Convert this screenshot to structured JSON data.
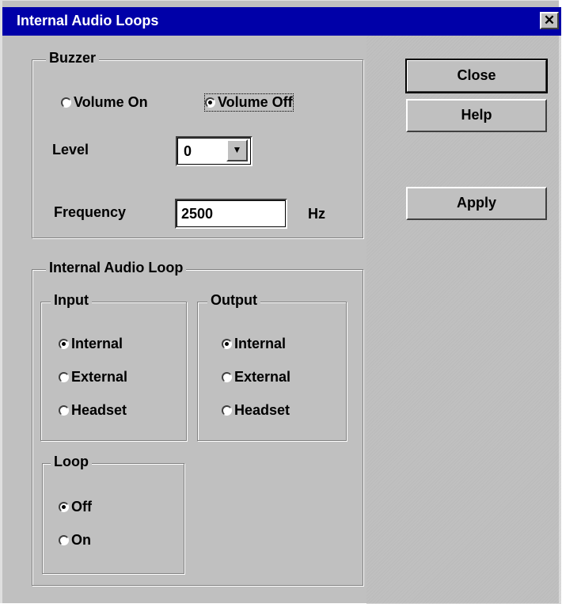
{
  "window": {
    "title": "Internal Audio Loops",
    "close_glyph": "✕"
  },
  "buzzer": {
    "legend": "Buzzer",
    "volume_on": "Volume On",
    "volume_off": "Volume Off",
    "volume_selected": "Volume Off",
    "level_label": "Level",
    "level_value": "0",
    "frequency_label": "Frequency",
    "frequency_value": "2500",
    "frequency_unit": "Hz"
  },
  "buttons": {
    "close": "Close",
    "help": "Help",
    "apply": "Apply"
  },
  "audio_loop": {
    "legend": "Internal Audio Loop",
    "input": {
      "legend": "Input",
      "options": [
        "Internal",
        "External",
        "Headset"
      ],
      "selected": "Internal"
    },
    "output": {
      "legend": "Output",
      "options": [
        "Internal",
        "External",
        "Headset"
      ],
      "selected": "Internal"
    },
    "loop": {
      "legend": "Loop",
      "options": [
        "Off",
        "On"
      ],
      "selected": "Off"
    }
  },
  "icons": {
    "dropdown": "chevron-down-icon",
    "radio": "radio-icon",
    "close": "close-icon"
  }
}
